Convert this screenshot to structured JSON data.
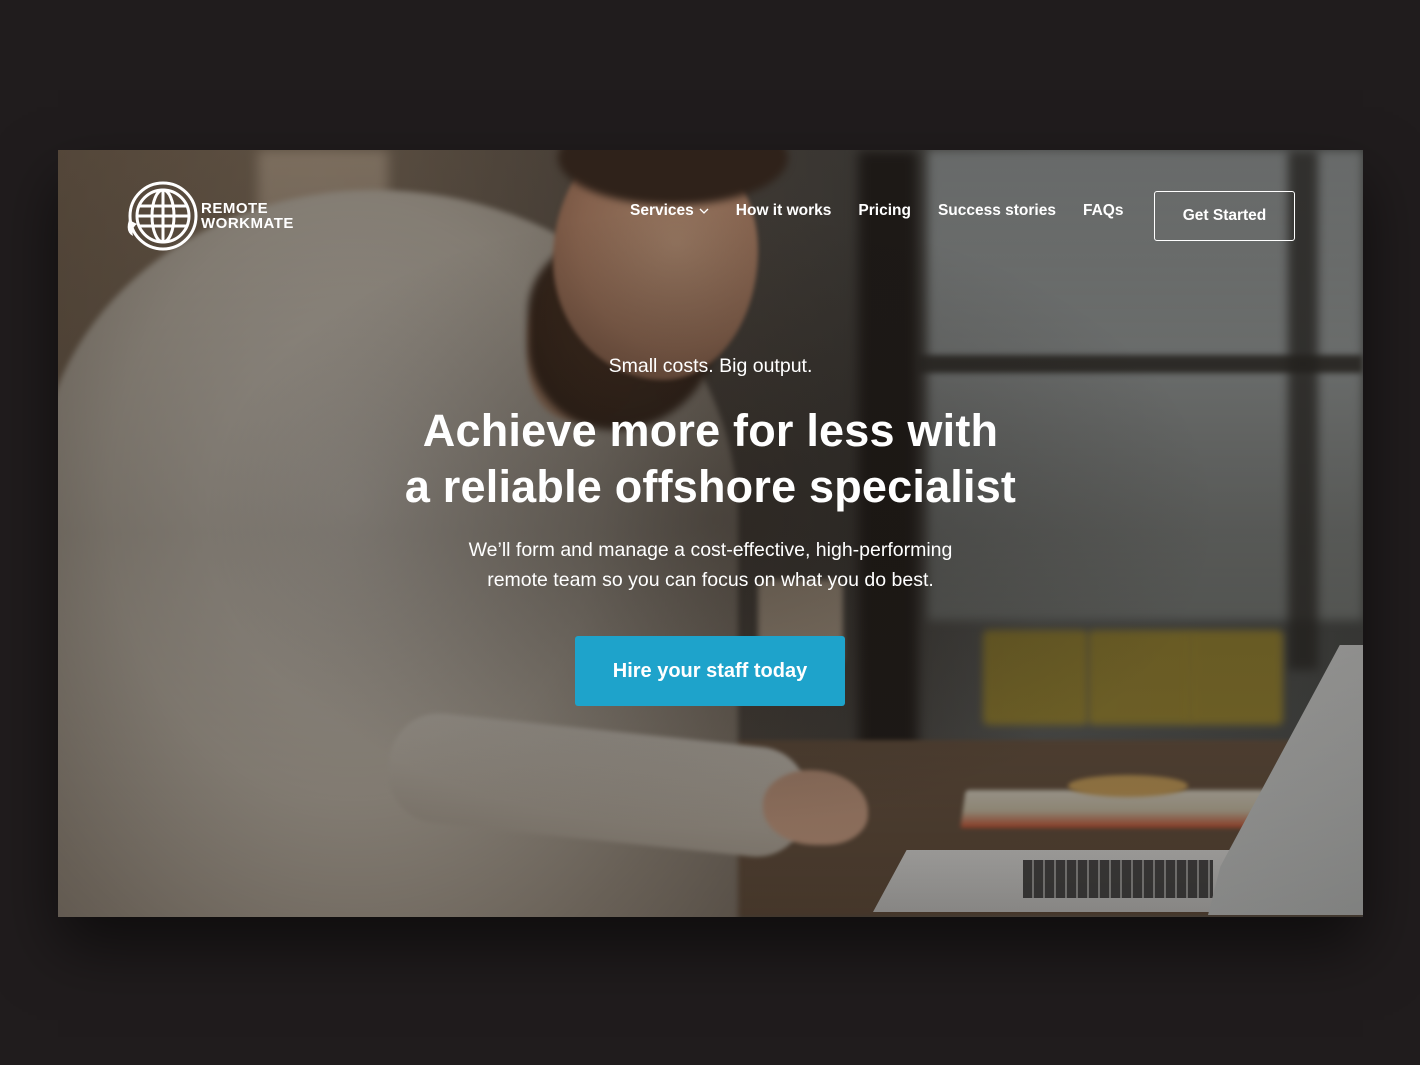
{
  "brand": {
    "logo_line1": "REMOTE",
    "logo_line2": "WORKMATE",
    "icon": "globe-logo-icon"
  },
  "nav": {
    "items": [
      {
        "label": "Services",
        "has_dropdown": true
      },
      {
        "label": "How it works"
      },
      {
        "label": "Pricing"
      },
      {
        "label": "Success stories"
      },
      {
        "label": "FAQs"
      }
    ],
    "cta_label": "Get Started"
  },
  "hero": {
    "tagline": "Small costs. Big output.",
    "headline_line1": "Achieve more for less with",
    "headline_line2": "a reliable offshore specialist",
    "subtext_line1": "We’ll form and manage a cost-effective, high-performing",
    "subtext_line2": "remote team so you can focus on what you do best.",
    "cta_label": "Hire your staff today"
  },
  "colors": {
    "page_background": "#201c1d",
    "cta_background": "#1ea3cb",
    "text": "#ffffff"
  }
}
